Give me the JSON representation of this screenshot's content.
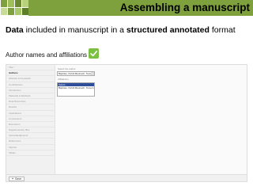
{
  "header": {
    "title": "Assembling a manuscript",
    "logo_colors": [
      "#7ea03d",
      "#9fbf58",
      "#6a8a30",
      "#b7d27a",
      "#c8dc9a",
      "#7ea03d",
      "#a9c86a",
      "#5d7d28"
    ],
    "band_color": "#7ea03d"
  },
  "headline": {
    "part1": "Data",
    "part2": " included in manuscript in a ",
    "part3": "structured annotated",
    "part4": " format"
  },
  "subline": {
    "label": "Author names and affiliations",
    "check_color": "#7cc043"
  },
  "screenshot": {
    "sidebar_items": [
      "Title *",
      "Authors",
      "Abstract & Keywords",
      "Contributions",
      "Introduction",
      "Materials & Methods",
      "Data Resources",
      "Results",
      "Implications",
      "Conclusions",
      "Discussion",
      "Supplementary files",
      "Acknowledgments",
      "References",
      "Figures",
      "Tables"
    ],
    "active_index": 1,
    "field1_label": "Select the author",
    "field1_value": "Baptiste, Petrič-Bannach, Tomerm",
    "field2_label": "Affiliations",
    "list_items": [
      "Select -",
      "Baptiste, Petrič-Bannach, Tomerm"
    ],
    "selected_list_index": 0,
    "save_label": "Save",
    "save_icon": "plus-icon"
  }
}
